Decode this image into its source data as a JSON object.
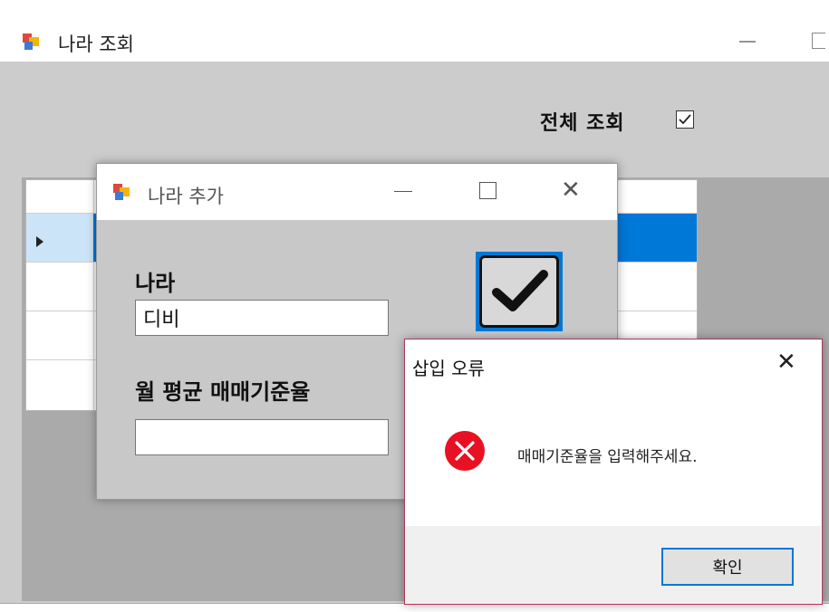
{
  "main_window": {
    "title": "나라 조회",
    "all_view_label": "전체 조회",
    "all_view_checked": true
  },
  "add_dialog": {
    "title": "나라 추가",
    "country_label": "나라",
    "country_value": "디비",
    "rate_label": "월 평균 매매기준율",
    "rate_value": ""
  },
  "error_dialog": {
    "title": "삽입 오류",
    "message": "매매기준율을 입력해주세요.",
    "ok_label": "확인"
  },
  "colors": {
    "accent": "#0078d7",
    "error_red": "#e81123"
  },
  "icons": [
    "app-icon",
    "minimize-icon",
    "maximize-icon",
    "close-icon",
    "checkmark-icon",
    "error-icon",
    "row-selector-arrow-icon"
  ]
}
